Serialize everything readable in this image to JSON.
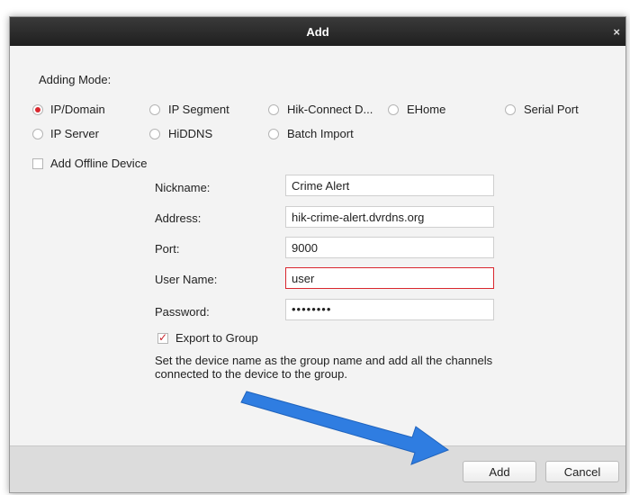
{
  "dialog": {
    "title": "Add",
    "close_glyph": "×",
    "adding_mode_label": "Adding Mode:",
    "modes": [
      {
        "label": "IP/Domain",
        "checked": true
      },
      {
        "label": "IP Segment",
        "checked": false
      },
      {
        "label": "Hik-Connect D...",
        "checked": false
      },
      {
        "label": "EHome",
        "checked": false
      },
      {
        "label": "Serial Port",
        "checked": false
      },
      {
        "label": "IP Server",
        "checked": false
      },
      {
        "label": "HiDDNS",
        "checked": false
      },
      {
        "label": "Batch Import",
        "checked": false
      }
    ],
    "offline_device": {
      "label": "Add Offline Device",
      "checked": false
    },
    "form": {
      "nickname": {
        "label": "Nickname:",
        "value": "Crime Alert"
      },
      "address": {
        "label": "Address:",
        "value": "hik-crime-alert.dvrdns.org"
      },
      "port": {
        "label": "Port:",
        "value": "9000"
      },
      "username": {
        "label": "User Name:",
        "value": "user"
      },
      "password": {
        "label": "Password:",
        "value": "••••••••"
      }
    },
    "export_group": {
      "label": "Export to Group",
      "checked": true
    },
    "export_description": "Set the device name as the group name and add all the channels connected to the device to the group.",
    "buttons": {
      "add": "Add",
      "cancel": "Cancel"
    }
  },
  "colors": {
    "accent_red": "#d9272e",
    "arrow_blue": "#2f7de1",
    "titlebar": "#262626"
  },
  "icons": {
    "close": "close-icon",
    "arrow": "pointer-arrow-icon"
  }
}
